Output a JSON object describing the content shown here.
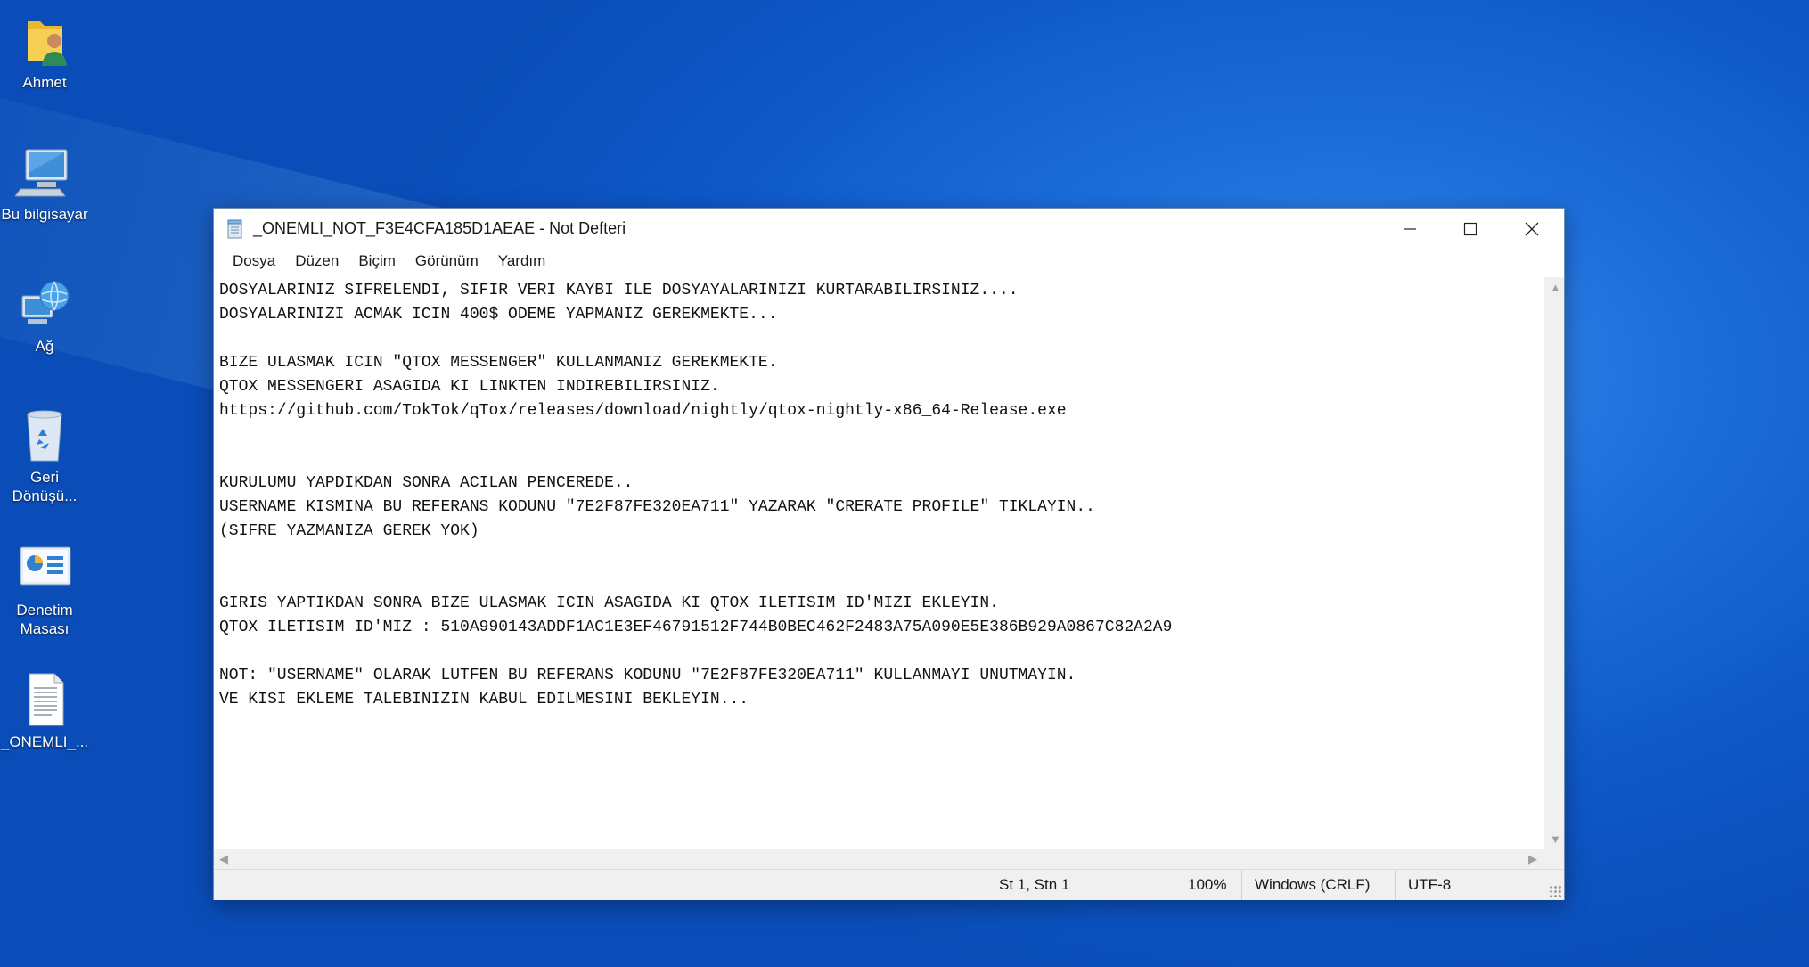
{
  "desktop": {
    "icons": [
      {
        "label": "Ahmet",
        "icon": "user-folder-icon"
      },
      {
        "label": "Bu bilgisayar",
        "icon": "computer-icon"
      },
      {
        "label": "Ağ",
        "icon": "network-globe-icon"
      },
      {
        "label": "Geri Dönüşü...",
        "icon": "recycle-bin-icon"
      },
      {
        "label": "Denetim Masası",
        "icon": "control-panel-icon"
      },
      {
        "label": "_ONEMLI_...",
        "icon": "text-document-icon"
      }
    ]
  },
  "window": {
    "title": "_ONEMLI_NOT_F3E4CFA185D1AEAE - Not Defteri",
    "menu": [
      "Dosya",
      "Düzen",
      "Biçim",
      "Görünüm",
      "Yardım"
    ],
    "content_lines": [
      "DOSYALARINIZ SIFRELENDI, SIFIR VERI KAYBI ILE DOSYAYALARINIZI KURTARABILIRSINIZ....",
      "DOSYALARINIZI ACMAK ICIN 400$ ODEME YAPMANIZ GEREKMEKTE...",
      "",
      "BIZE ULASMAK ICIN \"QTOX MESSENGER\" KULLANMANIZ GEREKMEKTE.",
      "QTOX MESSENGERI ASAGIDA KI LINKTEN INDIREBILIRSINIZ.",
      "https://github.com/TokTok/qTox/releases/download/nightly/qtox-nightly-x86_64-Release.exe",
      "",
      "",
      "KURULUMU YAPDIKDAN SONRA ACILAN PENCEREDE..",
      "USERNAME KISMINA BU REFERANS KODUNU \"7E2F87FE320EA711\" YAZARAK \"CRERATE PROFILE\" TIKLAYIN..",
      "(SIFRE YAZMANIZA GEREK YOK)",
      "",
      "",
      "GIRIS YAPTIKDAN SONRA BIZE ULASMAK ICIN ASAGIDA KI QTOX ILETISIM ID'MIZI EKLEYIN.",
      "QTOX ILETISIM ID'MIZ : 510A990143ADDF1AC1E3EF46791512F744B0BEC462F2483A75A090E5E386B929A0867C82A2A9",
      "",
      "NOT: \"USERNAME\" OLARAK LUTFEN BU REFERANS KODUNU \"7E2F87FE320EA711\" KULLANMAYI UNUTMAYIN.",
      "VE KISI EKLEME TALEBINIZIN KABUL EDILMESINI BEKLEYIN..."
    ],
    "status": {
      "position": "St 1, Stn 1",
      "zoom": "100%",
      "line_ending": "Windows (CRLF)",
      "encoding": "UTF-8"
    }
  }
}
